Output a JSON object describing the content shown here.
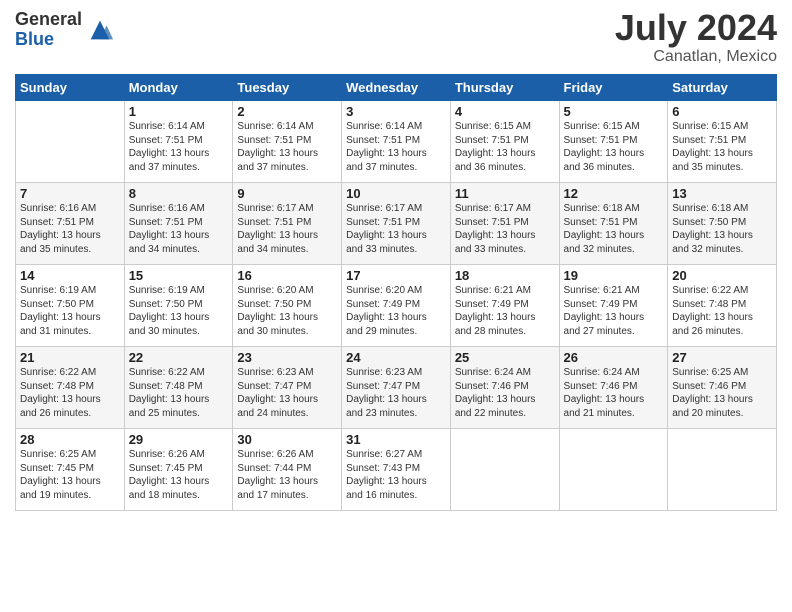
{
  "logo": {
    "general": "General",
    "blue": "Blue"
  },
  "title": "July 2024",
  "location": "Canatlan, Mexico",
  "days_of_week": [
    "Sunday",
    "Monday",
    "Tuesday",
    "Wednesday",
    "Thursday",
    "Friday",
    "Saturday"
  ],
  "weeks": [
    [
      {
        "day": "",
        "info": ""
      },
      {
        "day": "1",
        "info": "Sunrise: 6:14 AM\nSunset: 7:51 PM\nDaylight: 13 hours\nand 37 minutes."
      },
      {
        "day": "2",
        "info": "Sunrise: 6:14 AM\nSunset: 7:51 PM\nDaylight: 13 hours\nand 37 minutes."
      },
      {
        "day": "3",
        "info": "Sunrise: 6:14 AM\nSunset: 7:51 PM\nDaylight: 13 hours\nand 37 minutes."
      },
      {
        "day": "4",
        "info": "Sunrise: 6:15 AM\nSunset: 7:51 PM\nDaylight: 13 hours\nand 36 minutes."
      },
      {
        "day": "5",
        "info": "Sunrise: 6:15 AM\nSunset: 7:51 PM\nDaylight: 13 hours\nand 36 minutes."
      },
      {
        "day": "6",
        "info": "Sunrise: 6:15 AM\nSunset: 7:51 PM\nDaylight: 13 hours\nand 35 minutes."
      }
    ],
    [
      {
        "day": "7",
        "info": "Sunrise: 6:16 AM\nSunset: 7:51 PM\nDaylight: 13 hours\nand 35 minutes."
      },
      {
        "day": "8",
        "info": "Sunrise: 6:16 AM\nSunset: 7:51 PM\nDaylight: 13 hours\nand 34 minutes."
      },
      {
        "day": "9",
        "info": "Sunrise: 6:17 AM\nSunset: 7:51 PM\nDaylight: 13 hours\nand 34 minutes."
      },
      {
        "day": "10",
        "info": "Sunrise: 6:17 AM\nSunset: 7:51 PM\nDaylight: 13 hours\nand 33 minutes."
      },
      {
        "day": "11",
        "info": "Sunrise: 6:17 AM\nSunset: 7:51 PM\nDaylight: 13 hours\nand 33 minutes."
      },
      {
        "day": "12",
        "info": "Sunrise: 6:18 AM\nSunset: 7:51 PM\nDaylight: 13 hours\nand 32 minutes."
      },
      {
        "day": "13",
        "info": "Sunrise: 6:18 AM\nSunset: 7:50 PM\nDaylight: 13 hours\nand 32 minutes."
      }
    ],
    [
      {
        "day": "14",
        "info": "Sunrise: 6:19 AM\nSunset: 7:50 PM\nDaylight: 13 hours\nand 31 minutes."
      },
      {
        "day": "15",
        "info": "Sunrise: 6:19 AM\nSunset: 7:50 PM\nDaylight: 13 hours\nand 30 minutes."
      },
      {
        "day": "16",
        "info": "Sunrise: 6:20 AM\nSunset: 7:50 PM\nDaylight: 13 hours\nand 30 minutes."
      },
      {
        "day": "17",
        "info": "Sunrise: 6:20 AM\nSunset: 7:49 PM\nDaylight: 13 hours\nand 29 minutes."
      },
      {
        "day": "18",
        "info": "Sunrise: 6:21 AM\nSunset: 7:49 PM\nDaylight: 13 hours\nand 28 minutes."
      },
      {
        "day": "19",
        "info": "Sunrise: 6:21 AM\nSunset: 7:49 PM\nDaylight: 13 hours\nand 27 minutes."
      },
      {
        "day": "20",
        "info": "Sunrise: 6:22 AM\nSunset: 7:48 PM\nDaylight: 13 hours\nand 26 minutes."
      }
    ],
    [
      {
        "day": "21",
        "info": "Sunrise: 6:22 AM\nSunset: 7:48 PM\nDaylight: 13 hours\nand 26 minutes."
      },
      {
        "day": "22",
        "info": "Sunrise: 6:22 AM\nSunset: 7:48 PM\nDaylight: 13 hours\nand 25 minutes."
      },
      {
        "day": "23",
        "info": "Sunrise: 6:23 AM\nSunset: 7:47 PM\nDaylight: 13 hours\nand 24 minutes."
      },
      {
        "day": "24",
        "info": "Sunrise: 6:23 AM\nSunset: 7:47 PM\nDaylight: 13 hours\nand 23 minutes."
      },
      {
        "day": "25",
        "info": "Sunrise: 6:24 AM\nSunset: 7:46 PM\nDaylight: 13 hours\nand 22 minutes."
      },
      {
        "day": "26",
        "info": "Sunrise: 6:24 AM\nSunset: 7:46 PM\nDaylight: 13 hours\nand 21 minutes."
      },
      {
        "day": "27",
        "info": "Sunrise: 6:25 AM\nSunset: 7:46 PM\nDaylight: 13 hours\nand 20 minutes."
      }
    ],
    [
      {
        "day": "28",
        "info": "Sunrise: 6:25 AM\nSunset: 7:45 PM\nDaylight: 13 hours\nand 19 minutes."
      },
      {
        "day": "29",
        "info": "Sunrise: 6:26 AM\nSunset: 7:45 PM\nDaylight: 13 hours\nand 18 minutes."
      },
      {
        "day": "30",
        "info": "Sunrise: 6:26 AM\nSunset: 7:44 PM\nDaylight: 13 hours\nand 17 minutes."
      },
      {
        "day": "31",
        "info": "Sunrise: 6:27 AM\nSunset: 7:43 PM\nDaylight: 13 hours\nand 16 minutes."
      },
      {
        "day": "",
        "info": ""
      },
      {
        "day": "",
        "info": ""
      },
      {
        "day": "",
        "info": ""
      }
    ]
  ]
}
